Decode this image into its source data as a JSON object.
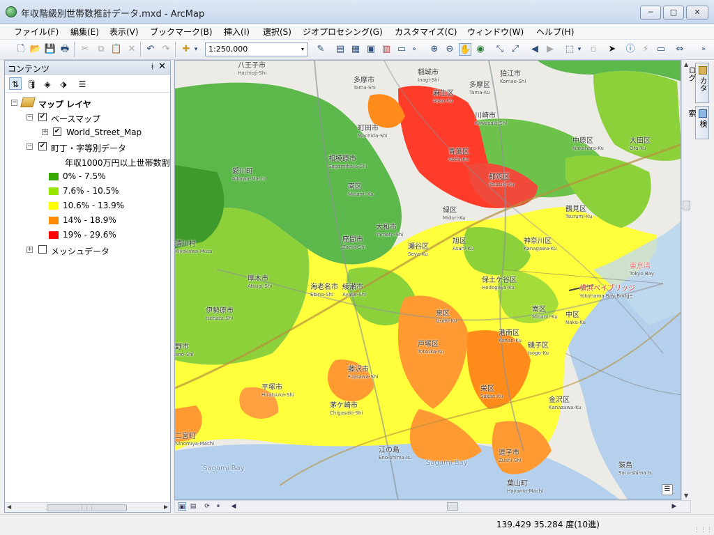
{
  "window": {
    "title": "年収階級別世帯数推計データ.mxd - ArcMap",
    "minimize": "─",
    "maximize": "□",
    "close": "✕"
  },
  "menu": [
    "ファイル(F)",
    "編集(E)",
    "表示(V)",
    "ブックマーク(B)",
    "挿入(I)",
    "選択(S)",
    "ジオプロセシング(G)",
    "カスタマイズ(C)",
    "ウィンドウ(W)",
    "ヘルプ(H)"
  ],
  "toolbar": {
    "scale_value": "1:250,000",
    "icons": [
      "new-icon",
      "open-icon",
      "save-icon",
      "print-icon",
      "cut-icon",
      "copy-icon",
      "paste-icon",
      "delete-icon",
      "undo-icon",
      "redo-icon",
      "add-data-icon"
    ],
    "glyphs": {
      "new": "🗋",
      "open": "📂",
      "save": "💾",
      "print": "🖶",
      "cut": "✂",
      "copy": "⧉",
      "paste": "📋",
      "delete": "✕",
      "undo": "↶",
      "redo": "↷",
      "add_data": "✚",
      "dropdown": "▾",
      "editor": "✎",
      "table": "▤",
      "layout": "▦",
      "catalog": "▣",
      "toolbox": "▥",
      "python": "▭",
      "more": "»",
      "zoom_in": "⊕",
      "zoom_out": "⊖",
      "pan": "✋",
      "globe": "◉",
      "fixed_in": "⤡",
      "fixed_out": "⤢",
      "back": "◀",
      "forward": "▶",
      "select_features": "⬚",
      "clear_selection": "▫",
      "select_elements": "➤",
      "identify": "ⓘ",
      "lightning": "⚡",
      "html_popup": "▭",
      "measure": "⇔"
    }
  },
  "toc": {
    "title": "コンテンツ",
    "pin": "ᚼ",
    "close": "✕",
    "tab_glyphs": [
      "⇅",
      "🛢",
      "◈",
      "⬗",
      "☰"
    ],
    "map_layers": "マップ レイヤ",
    "basemap_group": "ベースマップ",
    "street_layer": "World_Street_Map",
    "town_layer": "町丁・字等別データ",
    "field_label": "年収1000万円以上世帯数割",
    "legend": [
      {
        "label": "0% - 7.5%",
        "color": "#38a800"
      },
      {
        "label": "7.6% - 10.5%",
        "color": "#98e600"
      },
      {
        "label": "10.6% - 13.9%",
        "color": "#ffff00"
      },
      {
        "label": "14% - 18.9%",
        "color": "#ff8c00"
      },
      {
        "label": "19% - 29.6%",
        "color": "#ff0000"
      }
    ],
    "mesh_layer": "メッシュデータ",
    "expander_minus": "−",
    "expander_plus": "+",
    "check": "✔"
  },
  "map": {
    "places": [
      {
        "ja": "八王子市",
        "ro": "Hachioji-Shi"
      },
      {
        "ja": "多摩市",
        "ro": "Tama-Shi"
      },
      {
        "ja": "稲城市",
        "ro": "Inagi-Shi"
      },
      {
        "ja": "狛江市",
        "ro": "Komae-Shi"
      },
      {
        "ja": "麻生区",
        "ro": "Asao-Ku"
      },
      {
        "ja": "多摩区",
        "ro": "Tama-Ku"
      },
      {
        "ja": "川崎市",
        "ro": "Kawasaki-Shi"
      },
      {
        "ja": "町田市",
        "ro": "Machida-Shi"
      },
      {
        "ja": "青葉区",
        "ro": "Aoba-Ku"
      },
      {
        "ja": "都筑区",
        "ro": "Tsuzuki-Ku"
      },
      {
        "ja": "中原区",
        "ro": "Nakahara-Ku"
      },
      {
        "ja": "大田区",
        "ro": "Ota-Ku"
      },
      {
        "ja": "相模原市",
        "ro": "Sagamihara-Shi"
      },
      {
        "ja": "南区",
        "ro": "Minami-Ku"
      },
      {
        "ja": "愛川町",
        "ro": "Aikawa-Machi"
      },
      {
        "ja": "緑区",
        "ro": "Midori-Ku"
      },
      {
        "ja": "鶴見区",
        "ro": "Tsurumi-Ku"
      },
      {
        "ja": "大和市",
        "ro": "Yamato-Shi"
      },
      {
        "ja": "座間市",
        "ro": "Zama-Shi"
      },
      {
        "ja": "瀬谷区",
        "ro": "Seya-Ku"
      },
      {
        "ja": "旭区",
        "ro": "Asahi-Ku"
      },
      {
        "ja": "神奈川区",
        "ro": "Kanagawa-Ku"
      },
      {
        "ja": "清川村",
        "ro": "Kiyokawa-Mura"
      },
      {
        "ja": "厚木市",
        "ro": "Atsugi-Shi"
      },
      {
        "ja": "海老名市",
        "ro": "Ebina-Shi"
      },
      {
        "ja": "綾瀬市",
        "ro": "Ayase-Shi"
      },
      {
        "ja": "保土ケ谷区",
        "ro": "Hodogaya-Ku"
      },
      {
        "ja": "横浜ベイブリッジ",
        "ro": "Yokohama Bay Bridge"
      },
      {
        "ja": "伊勢原市",
        "ro": "Isehara-Shi"
      },
      {
        "ja": "泉区",
        "ro": "Izumi-Ku"
      },
      {
        "ja": "南区",
        "ro": "Minami-Ku"
      },
      {
        "ja": "中区",
        "ro": "Naka-Ku"
      },
      {
        "ja": "野市",
        "ro": "ano-Shi"
      },
      {
        "ja": "戸塚区",
        "ro": "Totsuka-Ku"
      },
      {
        "ja": "港南区",
        "ro": "Konan-Ku"
      },
      {
        "ja": "磯子区",
        "ro": "Isogo-Ku"
      },
      {
        "ja": "藤沢市",
        "ro": "Fujisawa-Shi"
      },
      {
        "ja": "平塚市",
        "ro": "Hiratsuka-Shi"
      },
      {
        "ja": "栄区",
        "ro": "Sakae-Ku"
      },
      {
        "ja": "金沢区",
        "ro": "Kanazawa-Ku"
      },
      {
        "ja": "茅ケ崎市",
        "ro": "Chigasaki-Shi"
      },
      {
        "ja": "二宮町",
        "ro": "Ninomiya-Machi"
      },
      {
        "ja": "江の島",
        "ro": "Eno-shima Is."
      },
      {
        "ja": "逗子市",
        "ro": "Zushi-Shi"
      },
      {
        "ja": "猿島",
        "ro": "Saru-shima Is."
      },
      {
        "ja": "葉山町",
        "ro": "Hayama-Machi"
      },
      {
        "ja": "東京湾",
        "ro": "Tokyo Bay"
      }
    ],
    "sea_labels": [
      "Sagami Bay",
      "Sagami Bay"
    ]
  },
  "right_dock": {
    "catalog": "カタログ",
    "search": "検索"
  },
  "status": {
    "coords": "139.429  35.284 度(10進)"
  },
  "scroll": {
    "up": "▲",
    "down": "▼",
    "left": "◀",
    "right": "▶",
    "grip": "⋮⋮⋮",
    "foot_btns": [
      "▣",
      "▤",
      "⟳",
      "⏸"
    ]
  }
}
